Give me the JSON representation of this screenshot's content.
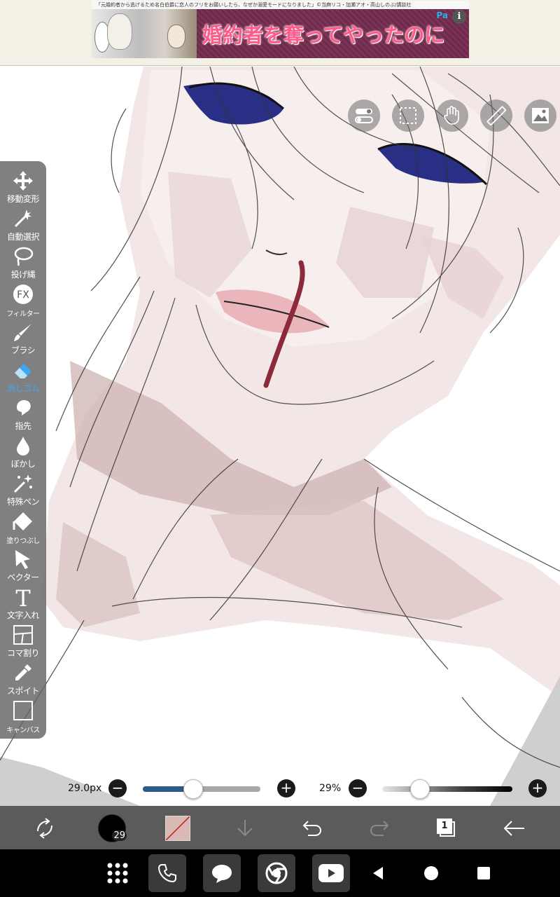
{
  "ad": {
    "top_text": "「元婚約者から逃げるため名白伯爵に恋人のフリをお願いしたら、なぜか溺愛モードになりました」©当麻リコ・加瀬アオ・高山しのぶ/講談社",
    "headline": "婚約者を奪ってやったのに",
    "badge": "Pa",
    "info_icon": "i"
  },
  "top_tools": [
    "toggle-icon",
    "selection-icon",
    "hand-icon",
    "ruler-icon",
    "image-icon"
  ],
  "left_toolbar": {
    "tools": [
      {
        "name": "move-transform",
        "label": "移動変形",
        "icon": "move-icon",
        "active": false
      },
      {
        "name": "auto-select",
        "label": "自動選択",
        "icon": "magic-wand-icon",
        "active": false
      },
      {
        "name": "lasso",
        "label": "投げ縄",
        "icon": "lasso-icon",
        "active": false
      },
      {
        "name": "filter",
        "label": "フィルター",
        "icon": "fx-icon",
        "active": false,
        "small": true
      },
      {
        "name": "brush",
        "label": "ブラシ",
        "icon": "brush-icon",
        "active": false
      },
      {
        "name": "eraser",
        "label": "消しゴム",
        "icon": "eraser-icon",
        "active": true
      },
      {
        "name": "finger",
        "label": "指先",
        "icon": "finger-icon",
        "active": false
      },
      {
        "name": "blur",
        "label": "ぼかし",
        "icon": "drop-icon",
        "active": false
      },
      {
        "name": "special-pen",
        "label": "特殊ペン",
        "icon": "sparkle-pen-icon",
        "active": false
      },
      {
        "name": "fill",
        "label": "塗りつぶし",
        "icon": "fill-icon",
        "active": false,
        "small": true
      },
      {
        "name": "vector",
        "label": "ベクター",
        "icon": "cursor-icon",
        "active": false
      },
      {
        "name": "text",
        "label": "文字入れ",
        "icon": "text-icon",
        "active": false
      },
      {
        "name": "frame-divide",
        "label": "コマ割り",
        "icon": "frame-icon",
        "active": false
      },
      {
        "name": "eyedropper",
        "label": "スポイト",
        "icon": "eyedropper-icon",
        "active": false
      },
      {
        "name": "canvas",
        "label": "キャンバス",
        "icon": "canvas-icon",
        "active": false,
        "small": true
      }
    ]
  },
  "sliders": {
    "size_label": "29.0px",
    "size_fraction": 0.43,
    "opacity_label": "29%",
    "opacity_fraction": 0.29,
    "minus": "−",
    "plus": "+"
  },
  "bottom_bar": {
    "brush_size": "29",
    "layer_count": "1",
    "icons": [
      "swap-icon",
      "brush-size-icon",
      "color-swatch",
      "download-icon",
      "undo-icon",
      "redo-icon",
      "layers-icon",
      "back-arrow-icon"
    ]
  },
  "system_bar": {
    "apps": [
      "apps-grid-icon",
      "phone-icon",
      "chat-icon",
      "chrome-icon",
      "youtube-icon"
    ],
    "nav": [
      "back-icon",
      "home-icon",
      "recents-icon"
    ]
  },
  "colors": {
    "active_tool": "#3ea6f2",
    "size_track": "#2b5b86",
    "toolbar_bg": "#646464",
    "bottom_bar": "#5b5b5b"
  }
}
